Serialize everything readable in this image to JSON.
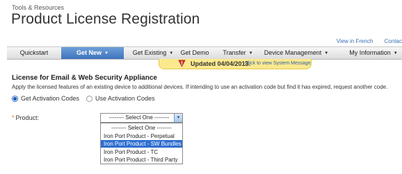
{
  "header": {
    "breadcrumb": "Tools & Resources",
    "title": "Product License Registration"
  },
  "top_links": [
    "View in French",
    "Contac"
  ],
  "nav": {
    "items": [
      {
        "label": "Quickstart",
        "caret": false
      },
      {
        "label": "Get New",
        "caret": true,
        "active": true
      },
      {
        "label": "Get Existing",
        "caret": true
      },
      {
        "label": "Get Demo",
        "caret": false
      },
      {
        "label": "Transfer",
        "caret": true
      },
      {
        "label": "Device Management",
        "caret": true
      },
      {
        "label": "My Information",
        "caret": true
      }
    ]
  },
  "alert": {
    "text": "Updated 04/04/2013.",
    "link": "Click to view System Message",
    "color": "#fce98e"
  },
  "section": {
    "title": "License for Email & Web Security Appliance",
    "description": "Apply the licensed features of an existing device to additional devices. If intending to use an activation code but find it has expired, request another code."
  },
  "options": {
    "radios": [
      {
        "label": "Get Activation Codes",
        "checked": true
      },
      {
        "label": "Use Activation Codes",
        "checked": false
      }
    ]
  },
  "product": {
    "required_mark": "*",
    "label": "Product:",
    "selected": "-------- Select One --------",
    "options": [
      "-------- Select One --------",
      "Iron Port Product - Perpetual",
      "Iron Port Product - SW Bundles",
      "Iron Port Product - TC",
      "Iron Port Product - Third Party"
    ],
    "highlighted_index": 2
  },
  "colors": {
    "accent": "#3d73bd",
    "link": "#3a6fb0",
    "highlight": "#2f6fd0"
  }
}
